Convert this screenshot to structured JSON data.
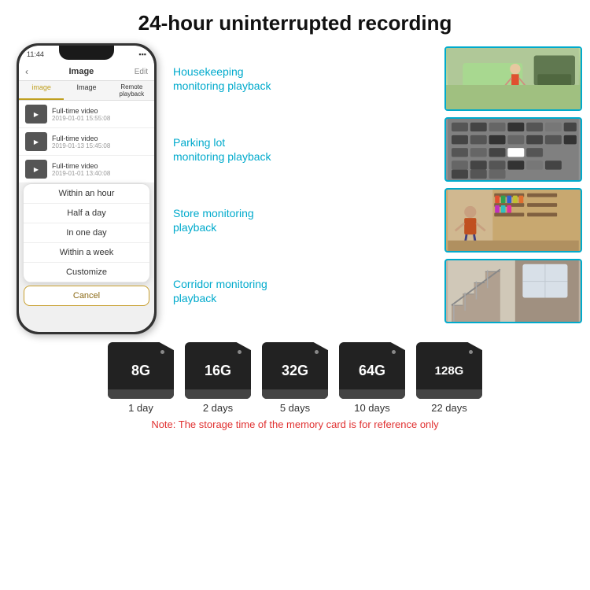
{
  "title": "24-hour uninterrupted recording",
  "phone": {
    "time": "11:44",
    "header_title": "Image",
    "header_edit": "Edit",
    "tab_image": "image",
    "tab_image2": "Image",
    "tab_remote": "Remote playback",
    "videos": [
      {
        "title": "Full-time video",
        "date": "2019-01-01 15:55:08"
      },
      {
        "title": "Full-time video",
        "date": "2019-01-13 15:45:08"
      },
      {
        "title": "Full-time video",
        "date": "2019-01-01 13:40:08"
      }
    ],
    "dropdown": {
      "items": [
        "Within an hour",
        "Half a day",
        "In one day",
        "Within a week",
        "Customize"
      ],
      "cancel": "Cancel"
    }
  },
  "monitoring": [
    {
      "label": "Housekeeping\nmonitoring playback",
      "img_class": "housekeeping-img"
    },
    {
      "label": "Parking lot\nmonitoring playback",
      "img_class": "parking-img"
    },
    {
      "label": "Store monitoring\nplayback",
      "img_class": "store-img"
    },
    {
      "label": "Corridor monitoring\nplayback",
      "img_class": "corridor-img"
    }
  ],
  "sd_cards": [
    {
      "size": "8G",
      "label": "1 day"
    },
    {
      "size": "16G",
      "label": "2 days"
    },
    {
      "size": "32G",
      "label": "5 days"
    },
    {
      "size": "64G",
      "label": "10 days"
    },
    {
      "size": "128G",
      "label": "22 days"
    }
  ],
  "note": "Note: The storage time of the memory card is for reference only"
}
